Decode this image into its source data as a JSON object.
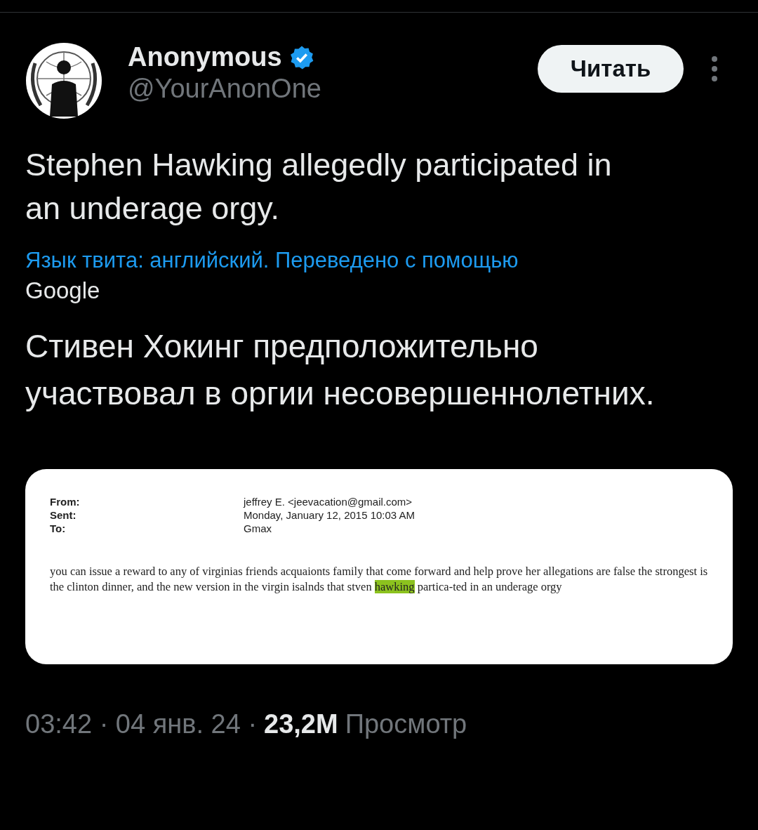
{
  "author": {
    "name": "Anonymous",
    "verified": true,
    "handle": "@YourAnonOne"
  },
  "follow_button": "Читать",
  "tweet_text": "Stephen Hawking allegedly participated in an underage orgy.",
  "translation_note": {
    "text": "Язык твита: английский. Переведено с помощью",
    "provider": "Google"
  },
  "translated_text": "Стивен Хокинг предположительно участвовал в оргии несовершеннолетних.",
  "document": {
    "headers": [
      {
        "label": "From:",
        "value": "jeffrey E. <jeevacation@gmail.com>"
      },
      {
        "label": "Sent:",
        "value": "Monday, January 12, 2015 10:03 AM"
      },
      {
        "label": "To:",
        "value": "Gmax"
      }
    ],
    "body_before": "you can issue a reward to any of virginias  friends acquaionts  family that come forward  and help prove her allegations are false  the strongest is the clinton dinner,  and the new version in the virgin isalnds  that stven",
    "body_highlight": "hawking",
    "body_after": "partica-ted in an underage orgy"
  },
  "meta": {
    "time": "03:42 · 04 янв. 24 ·",
    "views_count": "23,2M",
    "views_label": "Просмотр"
  }
}
